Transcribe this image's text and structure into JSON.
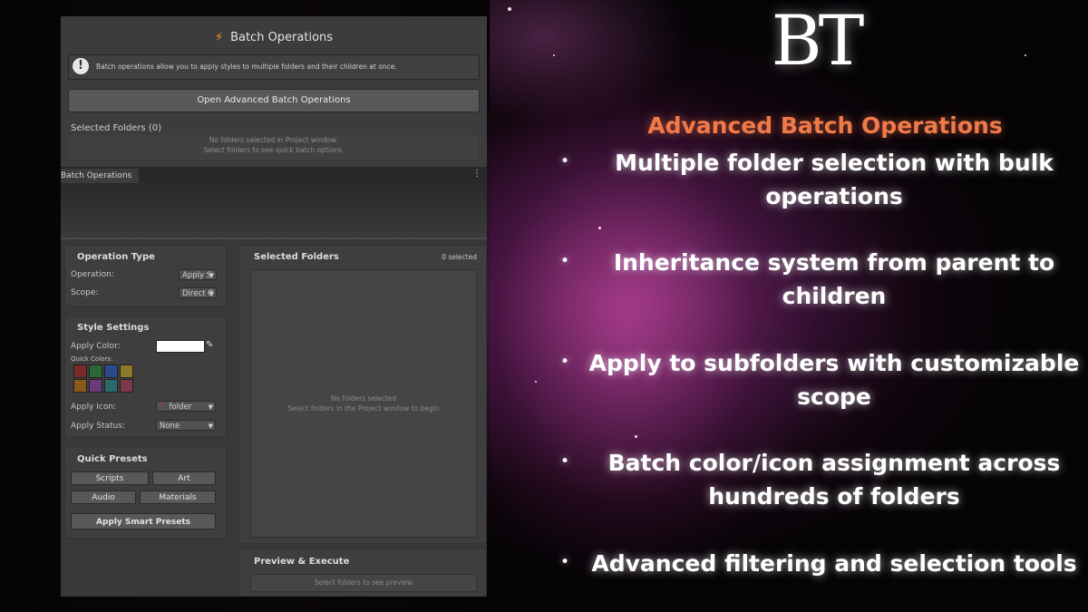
{
  "window": {
    "title": "Batch Operations",
    "info_text": "Batch operations allow you to apply styles to multiple folders and their children at once.",
    "open_advanced_label": "Open Advanced Batch Operations",
    "selected_folders_label": "Selected Folders (0)",
    "empty_line1": "No folders selected in Project window",
    "empty_line2": "Select folders to see quick batch options",
    "tab_label": "Batch Operations",
    "kebab": "⋮"
  },
  "operation_type": {
    "title": "Operation Type",
    "operation_label": "Operation:",
    "operation_value": "Apply S",
    "scope_label": "Scope:",
    "scope_value": "Direct C"
  },
  "style_settings": {
    "title": "Style Settings",
    "apply_color_label": "Apply Color:",
    "quick_colors_label": "Quick Colors:",
    "quick_colors": [
      "#7a2a2a",
      "#2a6a3a",
      "#2a4a8a",
      "#8a7a2a",
      "#8a5a1a",
      "#6a3a7a",
      "#2a6a6a",
      "#7a3a4a"
    ],
    "apply_icon_label": "Apply Icon:",
    "apply_icon_value": "folder",
    "apply_status_label": "Apply Status:",
    "apply_status_value": "None"
  },
  "quick_presets": {
    "title": "Quick Presets",
    "scripts": "Scripts",
    "art": "Art",
    "audio": "Audio",
    "materials": "Materials",
    "smart": "Apply Smart Presets"
  },
  "selected_panel": {
    "title": "Selected Folders",
    "count": "0 selected",
    "empty_line1": "No folders selected",
    "empty_line2": "Select folders in the Project window to begin"
  },
  "preview": {
    "title": "Preview & Execute",
    "hint": "Select folders to see preview"
  },
  "promo": {
    "logo": "BT",
    "heading": "Advanced Batch Operations",
    "bullet": "•",
    "features": [
      [
        "Multiple folder selection with bulk",
        "operations"
      ],
      [
        "Inheritance system from parent to",
        "children"
      ],
      [
        "Apply to subfolders with customizable",
        "scope"
      ],
      [
        "Batch color/icon assignment across",
        "hundreds of folders"
      ],
      [
        "Advanced filtering and selection tools"
      ]
    ]
  },
  "colors": {
    "accent": "#f39a24",
    "heading": "#f07a48",
    "panel": "#383838"
  }
}
